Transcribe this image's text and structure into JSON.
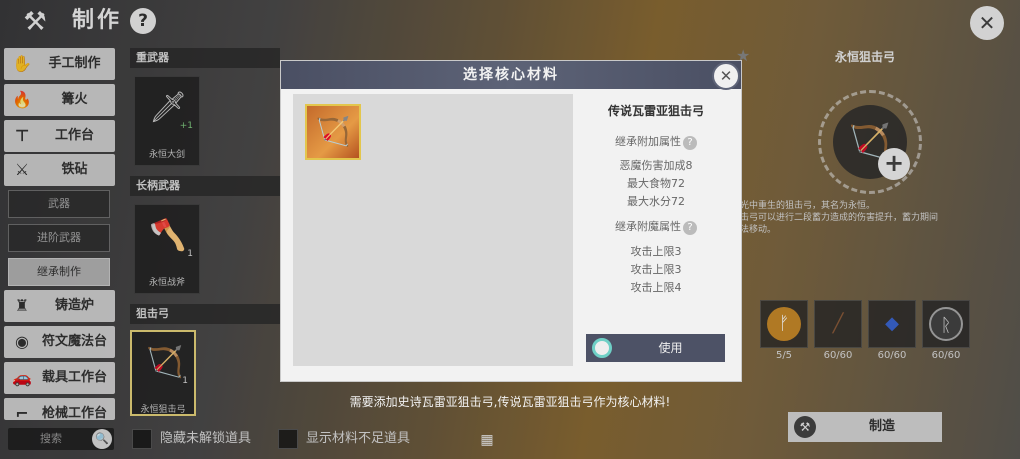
{
  "header": {
    "title": "制作",
    "help": "?",
    "close": "✕"
  },
  "sidebar": {
    "items": [
      {
        "label": "手工制作",
        "icon": "hand-icon"
      },
      {
        "label": "篝火",
        "icon": "campfire-icon"
      },
      {
        "label": "工作台",
        "icon": "workbench-icon"
      },
      {
        "label": "铁砧",
        "icon": "anvil-icon"
      }
    ],
    "subitems": [
      "武器",
      "进阶武器",
      "继承制作"
    ],
    "items2": [
      {
        "label": "铸造炉",
        "icon": "furnace-icon"
      },
      {
        "label": "符文魔法台",
        "icon": "rune-icon"
      },
      {
        "label": "载具工作台",
        "icon": "vehicle-icon"
      },
      {
        "label": "枪械工作台",
        "icon": "gun-icon"
      }
    ],
    "search_placeholder": "搜索"
  },
  "categories": [
    {
      "name": "重武器",
      "item": {
        "name": "永恒大剑",
        "count": "+1"
      }
    },
    {
      "name": "长柄武器",
      "item": {
        "name": "永恒战斧",
        "count": "1"
      }
    },
    {
      "name": "狙击弓",
      "item": {
        "name": "永恒狙击弓",
        "count": "1"
      }
    }
  ],
  "filters": {
    "hide_locked": "隐藏未解锁道具",
    "show_insufficient": "显示材料不足道具"
  },
  "right": {
    "title": "永恒狙击弓",
    "desc_lines": [
      "光中重生的狙击弓，其名为永恒。",
      "击弓可以进行二段蓄力造成的伤害提升，蓄力期间",
      "法移动。"
    ],
    "materials": [
      {
        "count": "5/5",
        "color": "#c98a2a"
      },
      {
        "count": "60/60",
        "color": "#5a3a2a"
      },
      {
        "count": "60/60",
        "color": "#2b4fa8"
      },
      {
        "count": "60/60",
        "color": "#555555"
      }
    ],
    "craft_label": "制造"
  },
  "modal": {
    "title": "选择核心材料",
    "item_title": "传说瓦雷亚狙击弓",
    "inherit_attr": "继承附加属性",
    "attr_lines": [
      "恶魔伤害加成8",
      "最大食物72",
      "最大水分72"
    ],
    "inherit_enchant": "继承附魔属性",
    "enchant_lines": [
      "攻击上限3",
      "攻击上限3",
      "攻击上限4"
    ],
    "use_label": "使用",
    "hint": "需要添加史诗瓦雷亚狙击弓,传说瓦雷亚狙击弓作为核心材料!"
  }
}
